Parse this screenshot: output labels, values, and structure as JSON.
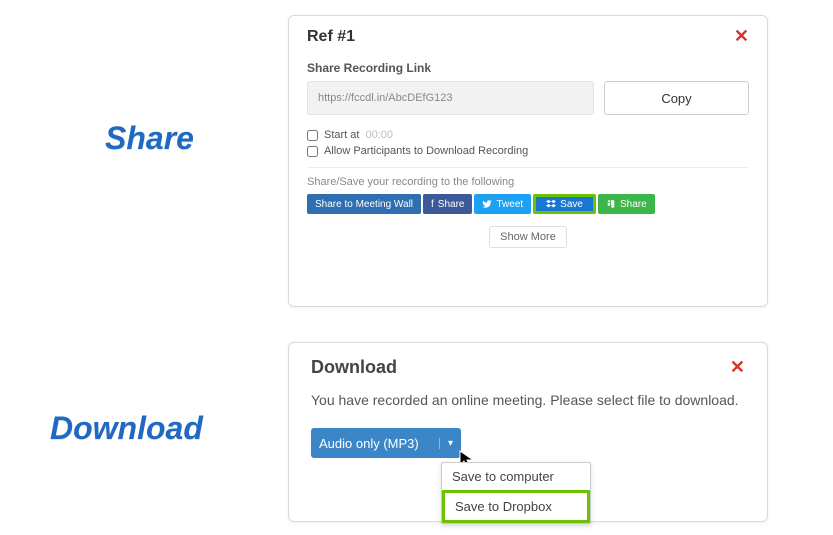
{
  "labels": {
    "share": "Share",
    "download": "Download"
  },
  "share_panel": {
    "title": "Ref #1",
    "close": "✕",
    "link_label": "Share Recording Link",
    "link_value": "https://fccdl.in/AbcDEfG123",
    "copy": "Copy",
    "start_at_label": "Start at",
    "start_at_time": "00:00",
    "allow_participants": "Allow Participants to Download Recording",
    "share_save_note": "Share/Save your recording to the following",
    "pills": {
      "wall": "Share to Meeting Wall",
      "fb": "Share",
      "tw": "Tweet",
      "dropbox": "Save",
      "ev": "Share"
    },
    "show_more": "Show More"
  },
  "download_panel": {
    "title": "Download",
    "close": "✕",
    "message": "You have recorded an online meeting. Please select file to download.",
    "dropdown_label": "Audio only (MP3)",
    "menu": {
      "computer": "Save to computer",
      "dropbox": "Save to Dropbox"
    }
  }
}
